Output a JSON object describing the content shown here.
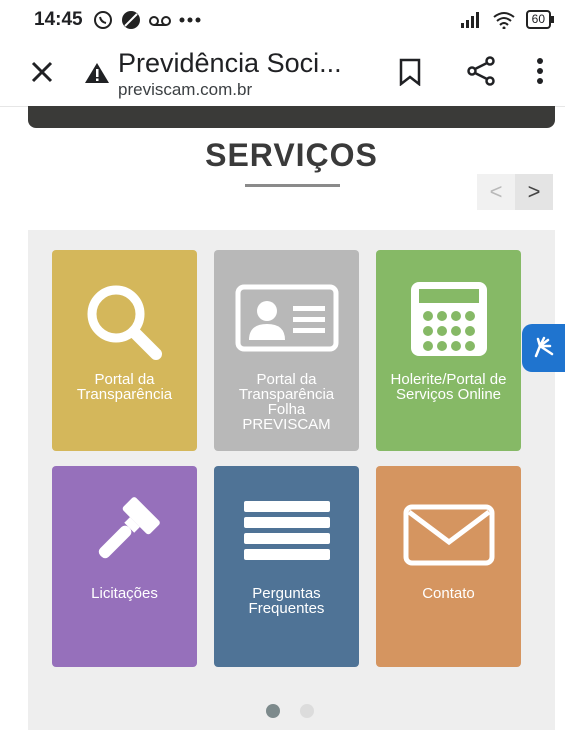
{
  "status_bar": {
    "time": "14:45",
    "battery": "60"
  },
  "toolbar": {
    "title": "Previdência Soci...",
    "url": "previscam.com.br"
  },
  "page": {
    "section_title": "SERVIÇOS",
    "prev_arrow": "<",
    "next_arrow": ">"
  },
  "tiles": [
    {
      "label": "Portal da Transparência",
      "color": "#d4b75b",
      "icon": "search-icon"
    },
    {
      "label": "Portal da Transparência Folha PREVISCAM",
      "color": "#b8b8b8",
      "icon": "id-card-icon"
    },
    {
      "label": "Holerite/Portal de Serviços Online",
      "color": "#86b966",
      "icon": "calculator-icon"
    },
    {
      "label": "Licitações",
      "color": "#9670bb",
      "icon": "gavel-icon"
    },
    {
      "label": "Perguntas Frequentes",
      "color": "#4f7396",
      "icon": "list-icon"
    },
    {
      "label": "Contato",
      "color": "#d59560",
      "icon": "envelope-icon"
    }
  ],
  "carousel": {
    "pages": 2,
    "active_page": 1
  }
}
